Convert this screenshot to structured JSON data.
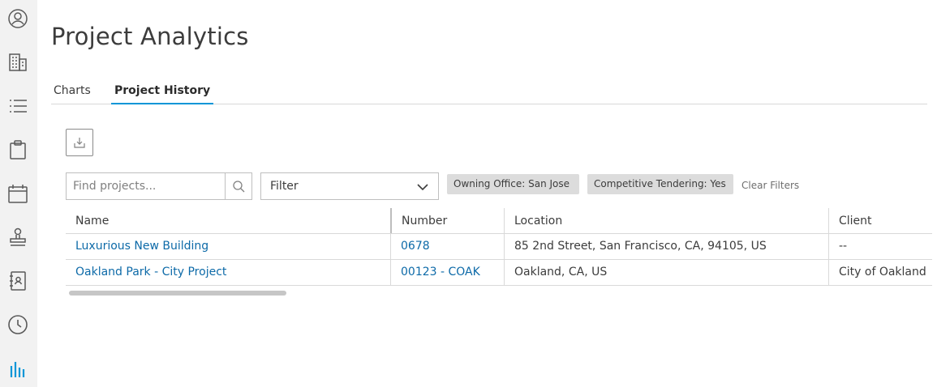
{
  "sidebar": {
    "items": [
      {
        "icon": "user-circle-icon"
      },
      {
        "icon": "building-icon"
      },
      {
        "icon": "list-icon"
      },
      {
        "icon": "clipboard-icon"
      },
      {
        "icon": "calendar-icon"
      },
      {
        "icon": "stamp-icon"
      },
      {
        "icon": "contacts-book-icon"
      },
      {
        "icon": "clock-icon"
      },
      {
        "icon": "analytics-icon",
        "active": true
      }
    ],
    "active_color": "#0696d7"
  },
  "page": {
    "title": "Project Analytics"
  },
  "tabs": [
    {
      "label": "Charts",
      "active": false
    },
    {
      "label": "Project History",
      "active": true
    }
  ],
  "toolbar": {
    "export_icon": "export-icon",
    "search": {
      "placeholder": "Find projects...",
      "value": ""
    },
    "filter": {
      "label": "Filter"
    },
    "chips": [
      "Owning Office: San Jose",
      "Competitive Tendering: Yes"
    ],
    "clear_label": "Clear Filters"
  },
  "table": {
    "columns": [
      "Name",
      "Number",
      "Location",
      "Client"
    ],
    "rows": [
      {
        "name": "Luxurious New Building",
        "number": "0678",
        "location": "85 2nd Street, San Francisco, CA, 94105, US",
        "client": "--"
      },
      {
        "name": "Oakland Park - City Project",
        "number": "00123 - COAK",
        "location": "Oakland, CA, US",
        "client": "City of Oakland"
      }
    ]
  },
  "colors": {
    "accent": "#0696d7",
    "link": "#0d6aa8"
  }
}
